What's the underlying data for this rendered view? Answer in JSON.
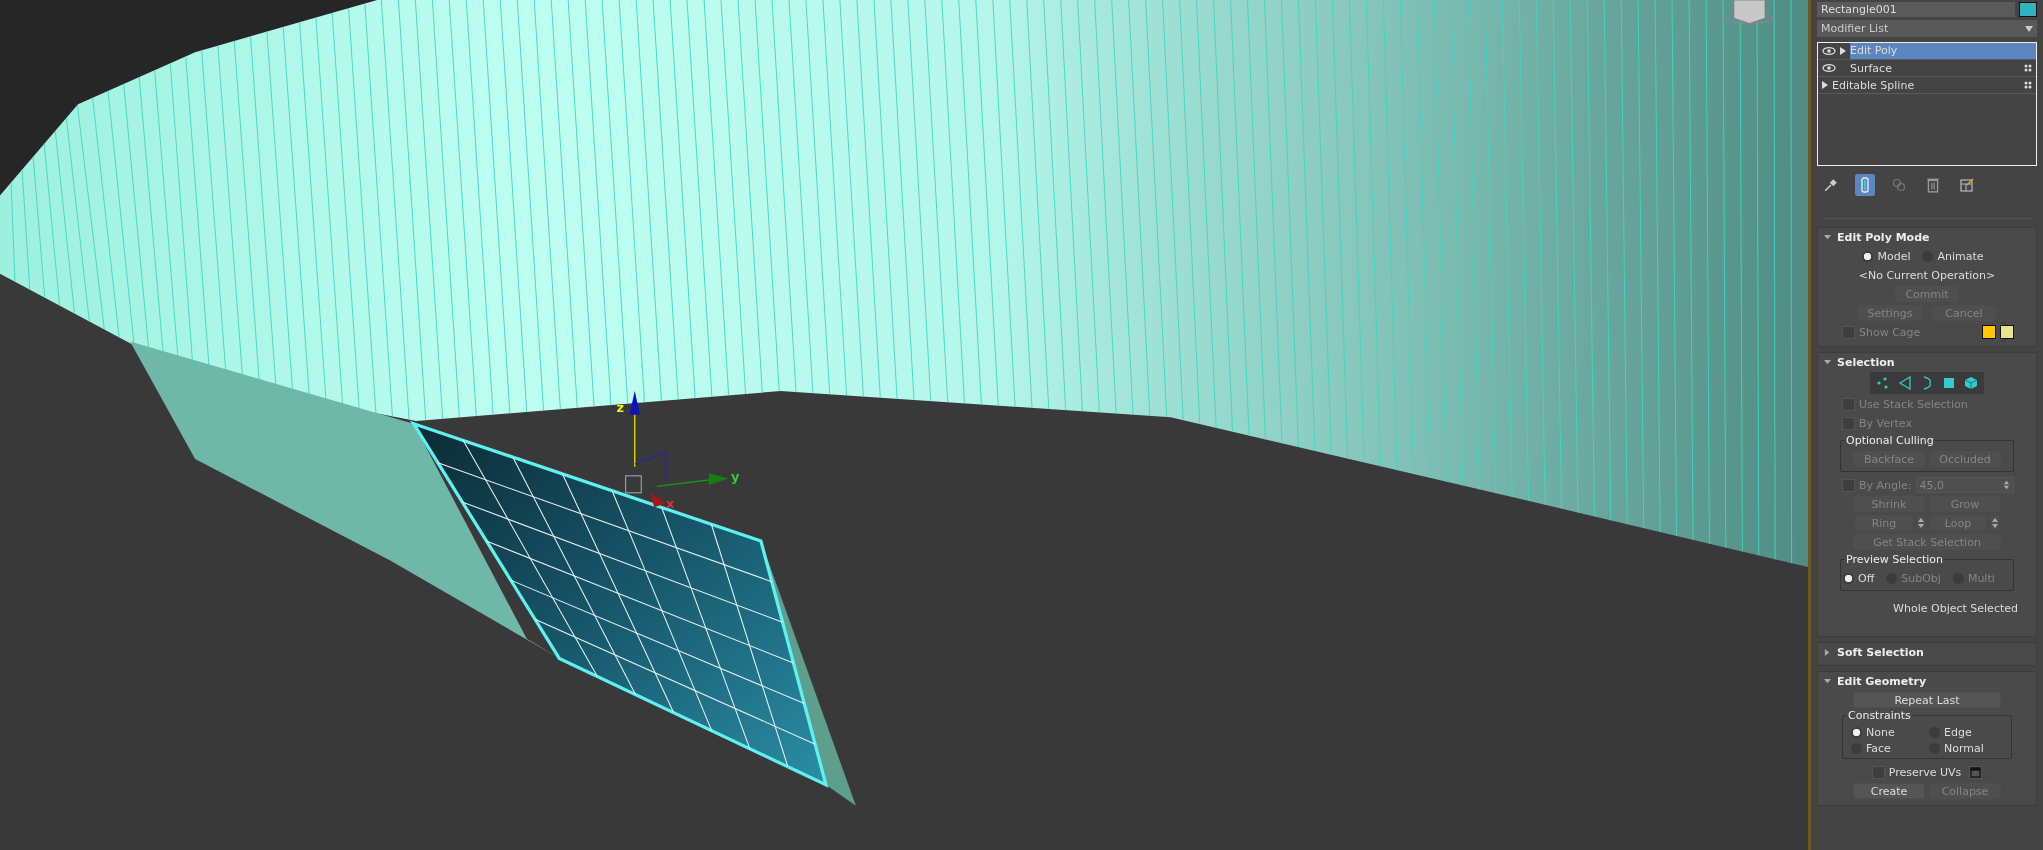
{
  "viewport": {
    "axis_labels": [
      {
        "kind": "z",
        "label": "z"
      },
      {
        "kind": "y",
        "label": "y"
      },
      {
        "kind": "x",
        "label": "x"
      }
    ]
  },
  "object_name": "Rectangle001",
  "modifier_list": {
    "label": "Modifier List"
  },
  "stack": [
    {
      "label": "Edit Poly",
      "kind": "modifier",
      "expandable": true,
      "grid_icon": false,
      "selected": true
    },
    {
      "label": "Surface",
      "kind": "modifier",
      "expandable": false,
      "grid_icon": true,
      "selected": false
    },
    {
      "label": "Editable Spline",
      "kind": "base",
      "expandable": true,
      "grid_icon": true,
      "selected": false
    }
  ],
  "toolbar": [
    {
      "kind": "pin",
      "on": false
    },
    {
      "kind": "end-result",
      "on": true
    },
    {
      "kind": "unique",
      "on": false
    },
    {
      "kind": "remove",
      "on": false
    },
    {
      "kind": "configure",
      "on": false
    }
  ],
  "edit_poly_mode": {
    "title": "Edit Poly Mode",
    "expanded": true,
    "modes": [
      {
        "label": "Model",
        "selected": true
      },
      {
        "label": "Animate",
        "selected": false
      }
    ],
    "operation": "<No Current Operation>",
    "commit": {
      "label": "Commit",
      "disabled": true
    },
    "settings": {
      "label": "Settings",
      "disabled": true
    },
    "cancel": {
      "label": "Cancel",
      "disabled": true
    },
    "show_cage": {
      "label": "Show Cage",
      "checked": false,
      "disabled": true
    },
    "cage_colors": [
      {
        "color": "#ffc800"
      },
      {
        "color": "#e6e68c"
      }
    ]
  },
  "selection": {
    "title": "Selection",
    "expanded": true,
    "levels": [
      {
        "kind": "vertex",
        "selected": false
      },
      {
        "kind": "edge",
        "selected": false
      },
      {
        "kind": "border",
        "selected": false
      },
      {
        "kind": "polygon",
        "selected": false
      },
      {
        "kind": "element",
        "selected": false
      }
    ],
    "use_stack_selection": {
      "label": "Use Stack Selection",
      "checked": false,
      "disabled": true
    },
    "by_vertex": {
      "label": "By Vertex",
      "checked": false,
      "disabled": true
    },
    "optional_culling": {
      "title": "Optional Culling",
      "buttons": [
        {
          "label": "Backface",
          "disabled": true
        },
        {
          "label": "Occluded",
          "disabled": true
        }
      ]
    },
    "by_angle": {
      "label": "By Angle:",
      "checked": false,
      "disabled": true,
      "value": "45,0"
    },
    "shrink": {
      "label": "Shrink",
      "disabled": true
    },
    "grow": {
      "label": "Grow",
      "disabled": true
    },
    "ring": {
      "label": "Ring",
      "disabled": true
    },
    "loop": {
      "label": "Loop",
      "disabled": true
    },
    "get_stack_selection": {
      "label": "Get Stack Selection",
      "disabled": true
    },
    "preview": {
      "title": "Preview Selection",
      "options": [
        {
          "label": "Off",
          "selected": true,
          "disabled": false
        },
        {
          "label": "SubObj",
          "selected": false,
          "disabled": true
        },
        {
          "label": "Multi",
          "selected": false,
          "disabled": true
        }
      ]
    },
    "status": "Whole Object Selected"
  },
  "soft_selection": {
    "title": "Soft Selection",
    "expanded": false
  },
  "edit_geometry": {
    "title": "Edit Geometry",
    "expanded": true,
    "repeat_last": {
      "label": "Repeat Last",
      "disabled": false
    },
    "constraints": {
      "title": "Constraints",
      "options": [
        {
          "label": "None",
          "selected": true
        },
        {
          "label": "Edge",
          "selected": false
        },
        {
          "label": "Face",
          "selected": false
        },
        {
          "label": "Normal",
          "selected": false
        }
      ]
    },
    "preserve_uvs": {
      "label": "Preserve UVs",
      "checked": false,
      "disabled": false
    },
    "create": {
      "label": "Create",
      "disabled": false
    },
    "collapse": {
      "label": "Collapse",
      "disabled": true
    }
  }
}
